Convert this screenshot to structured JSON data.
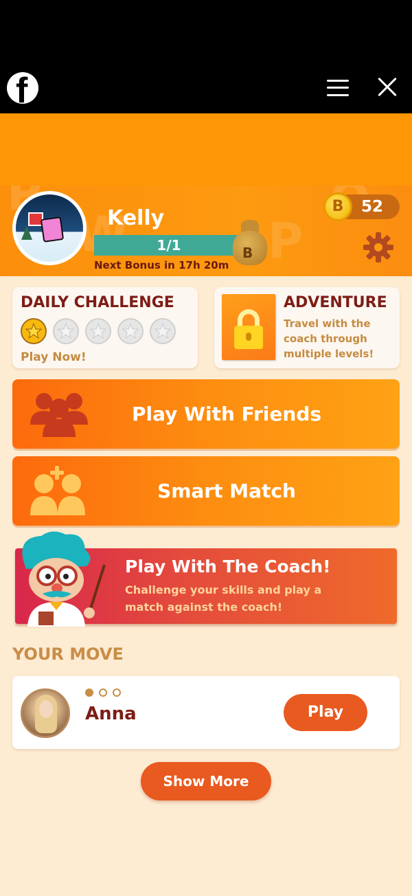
{
  "browser": {
    "logo_icon": "facebook-icon",
    "menu_icon": "hamburger-menu-icon",
    "close_icon": "close-icon"
  },
  "profile": {
    "name": "Kelly",
    "progress_text": "1/1",
    "progress_fraction": 1.0,
    "next_bonus": "Next Bonus in 17h 20m",
    "coins": "52",
    "coin_letter": "B",
    "bag_letter": "B"
  },
  "daily_challenge": {
    "title": "DAILY CHALLENGE",
    "stars_total": 5,
    "stars_earned": 1,
    "cta": "Play Now!"
  },
  "adventure": {
    "title": "ADVENTURE",
    "description": "Travel with the coach through multiple levels!"
  },
  "buttons": {
    "play_with_friends": "Play With Friends",
    "smart_match": "Smart Match"
  },
  "coach": {
    "title": "Play With The Coach!",
    "subtitle": "Challenge your skills and play a match against the coach!"
  },
  "your_move": {
    "heading": "YOUR MOVE",
    "games": [
      {
        "opponent": "Anna",
        "turn_dots_total": 3,
        "turn_dots_filled": 1,
        "action": "Play"
      }
    ],
    "show_more": "Show More"
  },
  "colors": {
    "orange": "#fe9606",
    "dark_red": "#7d1d16",
    "gold_text": "#c58b40",
    "button_red": "#e85a1f",
    "progress_teal": "#3a9d8b",
    "background": "#fdebd2"
  }
}
